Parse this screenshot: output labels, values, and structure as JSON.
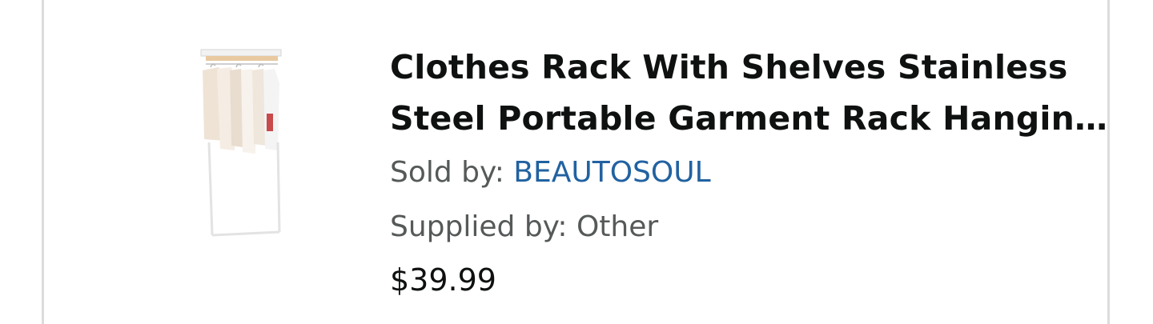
{
  "product": {
    "image_icon": "clothes-rack-photo",
    "title": "Clothes Rack With Shelves Stainless Steel Portable Garment Rack Hanging Clothes Organizer",
    "sold_by_label": "Sold by: ",
    "seller": "BEAUTOSOUL",
    "supplied_by_label": "Supplied by: ",
    "supplier": "Other",
    "price": "$39.99"
  },
  "colors": {
    "title": "#0f1111",
    "meta_text": "#565959",
    "link": "#2162a1",
    "card_border": "#dcdcdc"
  }
}
